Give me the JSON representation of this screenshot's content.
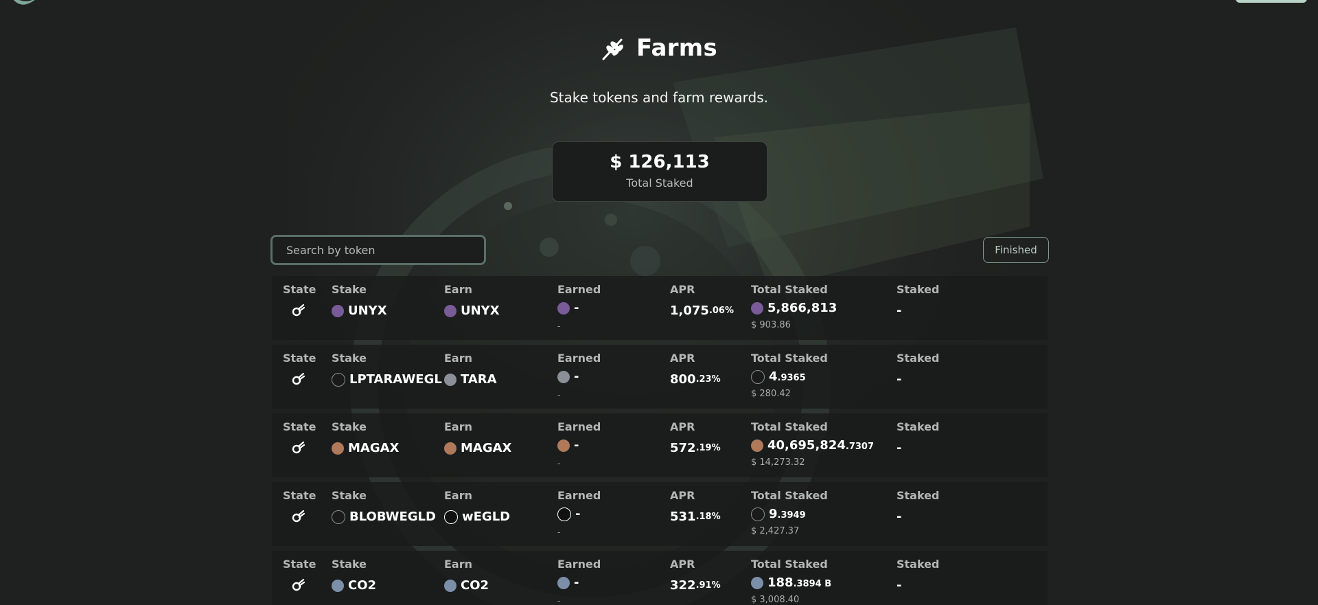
{
  "header": {
    "title": "Farms",
    "subtitle": "Stake tokens and farm rewards."
  },
  "stats": {
    "total_staked_value": "$ 126,113",
    "total_staked_label": "Total Staked"
  },
  "search": {
    "placeholder": "Search by token"
  },
  "filters": {
    "finished_label": "Finished"
  },
  "columns": {
    "state": "State",
    "stake": "Stake",
    "earn": "Earn",
    "earned": "Earned",
    "apr": "APR",
    "total_staked": "Total Staked",
    "staked": "Staked"
  },
  "icons": {
    "title": "wheat-icon",
    "state": "comet-icon"
  },
  "colors": {
    "background": "#1f2120",
    "accent_border": "#5b6e69",
    "button_border": "#7c9a92"
  },
  "farms": [
    {
      "stake_token": "UNYX",
      "earn_token": "UNYX",
      "earned": "-",
      "earned_usd": "-",
      "apr_main": "1,075",
      "apr_decimal": ".06%",
      "total_main": "5,866,813",
      "total_decimal": "",
      "total_suffix": "",
      "total_usd": "$ 903.86",
      "staked": "-",
      "stake_icon": "unyx-icon",
      "earn_icon": "unyx-icon"
    },
    {
      "stake_token": "LPTARAWEGL",
      "earn_token": "TARA",
      "earned": "-",
      "earned_usd": "-",
      "apr_main": "800",
      "apr_decimal": ".23%",
      "total_main": "4",
      "total_decimal": ".9365",
      "total_suffix": "",
      "total_usd": "$ 280.42",
      "staked": "-",
      "stake_icon": "unknown-token-icon",
      "earn_icon": "tara-icon"
    },
    {
      "stake_token": "MAGAX",
      "earn_token": "MAGAX",
      "earned": "-",
      "earned_usd": "-",
      "apr_main": "572",
      "apr_decimal": ".19%",
      "total_main": "40,695,824",
      "total_decimal": ".7307",
      "total_suffix": "",
      "total_usd": "$ 14,273.32",
      "staked": "-",
      "stake_icon": "magax-icon",
      "earn_icon": "magax-icon"
    },
    {
      "stake_token": "BLOBWEGLD",
      "earn_token": "wEGLD",
      "earned": "-",
      "earned_usd": "-",
      "apr_main": "531",
      "apr_decimal": ".18%",
      "total_main": "9",
      "total_decimal": ".3949",
      "total_suffix": "",
      "total_usd": "$ 2,427.37",
      "staked": "-",
      "stake_icon": "unknown-token-icon",
      "earn_icon": "wegld-icon"
    },
    {
      "stake_token": "CO2",
      "earn_token": "CO2",
      "earned": "-",
      "earned_usd": "-",
      "apr_main": "322",
      "apr_decimal": ".91%",
      "total_main": "188",
      "total_decimal": ".3894",
      "total_suffix": " B",
      "total_usd": "$ 3,008.40",
      "staked": "-",
      "stake_icon": "co2-icon",
      "earn_icon": "co2-icon"
    }
  ]
}
